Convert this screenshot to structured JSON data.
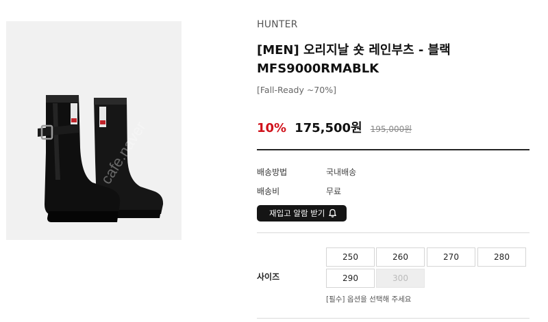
{
  "product": {
    "brand": "HUNTER",
    "title_line1": "[MEN] 오리지날 숏 레인부츠 - 블랙",
    "title_line2": "MFS9000RMABLK",
    "subtitle": "[Fall-Ready ~70%]",
    "discount": "10%",
    "price": "175,500원",
    "original_price": "195,000원"
  },
  "shipping": {
    "method_label": "배송방법",
    "method_value": "국내배송",
    "fee_label": "배송비",
    "fee_value": "무료"
  },
  "restock_button": {
    "label": "재입고 알람 받기",
    "icon": "bell-icon"
  },
  "size": {
    "label": "사이즈",
    "options": [
      {
        "label": "250",
        "available": true
      },
      {
        "label": "260",
        "available": true
      },
      {
        "label": "270",
        "available": true
      },
      {
        "label": "280",
        "available": true
      },
      {
        "label": "290",
        "available": true
      },
      {
        "label": "300",
        "available": false
      }
    ],
    "note": "[필수] 옵션을 선택해 주세요"
  },
  "image": {
    "watermark": "cafe.naver",
    "subject": "black rain boots"
  },
  "colors": {
    "discount": "#d0121b",
    "button_bg": "#151515",
    "image_bg": "#f1f1f1"
  }
}
